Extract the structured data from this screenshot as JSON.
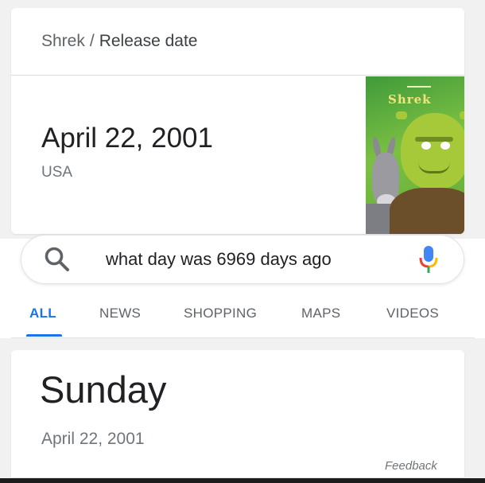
{
  "knowledge_panel": {
    "breadcrumb": {
      "entity": "Shrek",
      "separator": "/",
      "attribute": "Release date"
    },
    "answer": "April 22, 2001",
    "region": "USA",
    "poster": {
      "title": "Shrek"
    }
  },
  "search": {
    "query": "what day was 6969 days ago",
    "search_icon": "search-icon",
    "mic_icon": "microphone-icon",
    "colors": {
      "mic_blue": "#4285f4",
      "mic_red": "#ea4335",
      "mic_yellow": "#fbbc05",
      "mic_green": "#34a853"
    }
  },
  "tabs": [
    {
      "label": "ALL",
      "active": true
    },
    {
      "label": "NEWS",
      "active": false
    },
    {
      "label": "SHOPPING",
      "active": false
    },
    {
      "label": "MAPS",
      "active": false
    },
    {
      "label": "VIDEOS",
      "active": false
    }
  ],
  "result": {
    "day": "Sunday",
    "date": "April 22, 2001",
    "feedback": "Feedback"
  },
  "colors": {
    "accent": "#1a73e8",
    "text_primary": "#202124",
    "text_secondary": "#70757a",
    "background": "#f1f1f1"
  }
}
